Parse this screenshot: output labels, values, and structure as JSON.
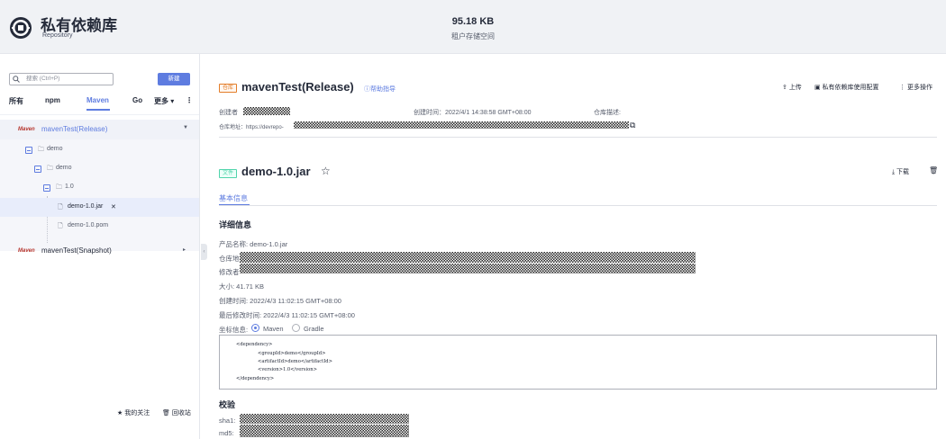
{
  "header": {
    "title": "私有依赖库",
    "subtitle": "Repository",
    "storage_value": "95.18 KB",
    "storage_label": "租户存储空间"
  },
  "sidebar": {
    "search_placeholder": "搜索 (Ctrl+P)",
    "new_button": "新建",
    "tabs": [
      "所有",
      "npm",
      "Maven",
      "Go",
      "更多"
    ],
    "active_tab": "Maven",
    "repos": [
      {
        "badge": "Maven",
        "name": "mavenTest(Release)"
      },
      {
        "badge": "Maven",
        "name": "mavenTest(Snapshot)"
      }
    ],
    "tree": [
      "demo",
      "demo",
      "1.0",
      "demo-1.0.jar",
      "demo-1.0.pom"
    ],
    "footer_follow": "我的关注",
    "footer_recycle": "回收站"
  },
  "repo": {
    "tag": "仓库",
    "name": "mavenTest(Release)",
    "help": "帮助指导",
    "actions": {
      "upload": "上传",
      "config": "私有依赖库使用配置",
      "more": "更多操作"
    },
    "creator_label": "创建者",
    "created_time": "创建时间：2022/4/1 14:38:58 GMT+08:00",
    "desc_label": "仓库描述:",
    "address_label": "仓库地址：https://devrepo-"
  },
  "file": {
    "tag": "文件",
    "name": "demo-1.0.jar",
    "download": "下载",
    "tab": "基本信息",
    "detail_title": "详细信息",
    "product_name": "产品名称: demo-1.0.jar",
    "repo_addr_label": "仓库地",
    "modifier_label": "修改者",
    "size": "大小: 41.71 KB",
    "created": "创建时间: 2022/4/3 11:02:15 GMT+08:00",
    "modified": "最后修改时间: 2022/4/3 11:02:15 GMT+08:00",
    "coord_label": "坐标信息:",
    "coord_options": [
      "Maven",
      "Gradle"
    ],
    "coord_selected": "Maven",
    "code_lines": [
      "<dependency>",
      "<groupId>demo</groupId>",
      "<artifactId>demo</artifactId>",
      "<version>1.0</version>",
      "</dependency>"
    ],
    "checksum_title": "校验",
    "sha1_label": "sha1:",
    "md5_label": "md5:"
  },
  "colors": {
    "accent": "#5e7ce0",
    "tag_orange": "#e37d29",
    "tag_green": "#50d4ab",
    "maven_red": "#b5332b"
  }
}
